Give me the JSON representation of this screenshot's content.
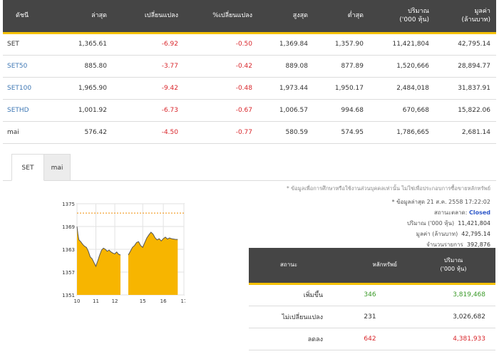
{
  "index_table": {
    "headers": [
      "ดัชนี",
      "ล่าสุด",
      "เปลี่ยนแปลง",
      "%เปลี่ยนแปลง",
      "สูงสุด",
      "ต่ำสุด",
      "ปริมาณ\n('000 หุ้น)",
      "มูลค่า\n(ล้านบาท)"
    ],
    "rows": [
      [
        "SET",
        "1,365.61",
        "-6.92",
        "-0.50",
        "1,369.84",
        "1,357.90",
        "11,421,804",
        "42,795.14"
      ],
      [
        "SET50",
        "885.80",
        "-3.77",
        "-0.42",
        "889.08",
        "877.89",
        "1,520,666",
        "28,894.77"
      ],
      [
        "SET100",
        "1,965.90",
        "-9.42",
        "-0.48",
        "1,973.44",
        "1,950.17",
        "2,484,018",
        "31,837.91"
      ],
      [
        "SETHD",
        "1,001.92",
        "-6.73",
        "-0.67",
        "1,006.57",
        "994.68",
        "670,668",
        "15,822.06"
      ],
      [
        "mai",
        "576.42",
        "-4.50",
        "-0.77",
        "580.59",
        "574.95",
        "1,786,665",
        "2,681.14"
      ]
    ]
  },
  "tabs": {
    "set": "SET",
    "mai": "mai"
  },
  "info": {
    "disclaimer": "* ข้อมูลเพื่อการศึกษาหรือใช้งานส่วนบุคคลเท่านั้น ไม่ใช่เพื่อประกอบการซื้อขายหลักทรัพย์",
    "updated": "* ข้อมูลล่าสุด 21 ส.ค. 2558 17:22:02",
    "market_status_label": "สถานะตลาด:",
    "market_status": "Closed",
    "volume_label": "ปริมาณ ('000 หุ้น)",
    "volume": "11,421,804",
    "value_label": "มูลค่า (ล้านบาท)",
    "value": "42,795.14",
    "trades_label": "จำนวนรายการ",
    "trades": "392,876"
  },
  "adv_table": {
    "headers": [
      "สถานะ",
      "หลักทรัพย์",
      "ปริมาณ\n('000 หุ้น)"
    ],
    "rows": [
      {
        "label": "เพิ่มขึ้น",
        "count": "346",
        "volume": "3,819,468",
        "color": "#3a9a28"
      },
      {
        "label": "ไม่เปลี่ยนแปลง",
        "count": "231",
        "volume": "3,026,682",
        "color": "#333333"
      },
      {
        "label": "ลดลง",
        "count": "642",
        "volume": "4,381,933",
        "color": "#d9262b"
      }
    ]
  },
  "chart_data": {
    "type": "area",
    "y_ticks": [
      "1375",
      "1369",
      "1363",
      "1357",
      "1351"
    ],
    "x_ticks": [
      "10",
      "11",
      "12",
      "15",
      "16",
      "17"
    ],
    "ylim": [
      1351,
      1375
    ],
    "xlim": [
      10,
      17
    ],
    "reference_line": 1372.53,
    "fill_color": "#f7b500",
    "line_color": "#555555",
    "series": [
      {
        "session": "morning",
        "points": [
          [
            10.0,
            1369.0
          ],
          [
            10.05,
            1367.0
          ],
          [
            10.1,
            1365.5
          ],
          [
            10.2,
            1365.0
          ],
          [
            10.3,
            1364.3
          ],
          [
            10.4,
            1363.8
          ],
          [
            10.5,
            1363.5
          ],
          [
            10.6,
            1362.5
          ],
          [
            10.7,
            1361.0
          ],
          [
            10.8,
            1360.5
          ],
          [
            10.9,
            1359.5
          ],
          [
            11.0,
            1358.5
          ],
          [
            11.1,
            1360.0
          ],
          [
            11.2,
            1361.5
          ],
          [
            11.3,
            1362.8
          ],
          [
            11.4,
            1363.3
          ],
          [
            11.5,
            1363.0
          ],
          [
            11.6,
            1362.5
          ],
          [
            11.7,
            1362.8
          ],
          [
            11.8,
            1362.3
          ],
          [
            11.9,
            1362.0
          ],
          [
            12.0,
            1361.8
          ],
          [
            12.1,
            1362.3
          ],
          [
            12.2,
            1361.7
          ],
          [
            12.3,
            1361.5
          ]
        ]
      },
      {
        "session": "afternoon",
        "points": [
          [
            14.3,
            1361.5
          ],
          [
            14.4,
            1362.5
          ],
          [
            14.5,
            1363.5
          ],
          [
            14.6,
            1364.0
          ],
          [
            14.7,
            1364.8
          ],
          [
            14.8,
            1365.0
          ],
          [
            14.9,
            1364.0
          ],
          [
            15.0,
            1363.5
          ],
          [
            15.1,
            1364.8
          ],
          [
            15.2,
            1366.0
          ],
          [
            15.3,
            1366.8
          ],
          [
            15.4,
            1367.5
          ],
          [
            15.5,
            1367.0
          ],
          [
            15.6,
            1366.0
          ],
          [
            15.7,
            1365.5
          ],
          [
            15.8,
            1365.8
          ],
          [
            15.9,
            1365.2
          ],
          [
            16.0,
            1365.8
          ],
          [
            16.1,
            1366.2
          ],
          [
            16.2,
            1365.7
          ],
          [
            16.3,
            1366.0
          ],
          [
            16.4,
            1365.8
          ],
          [
            16.5,
            1365.7
          ],
          [
            16.6,
            1365.6
          ],
          [
            16.7,
            1365.6
          ]
        ]
      }
    ]
  }
}
